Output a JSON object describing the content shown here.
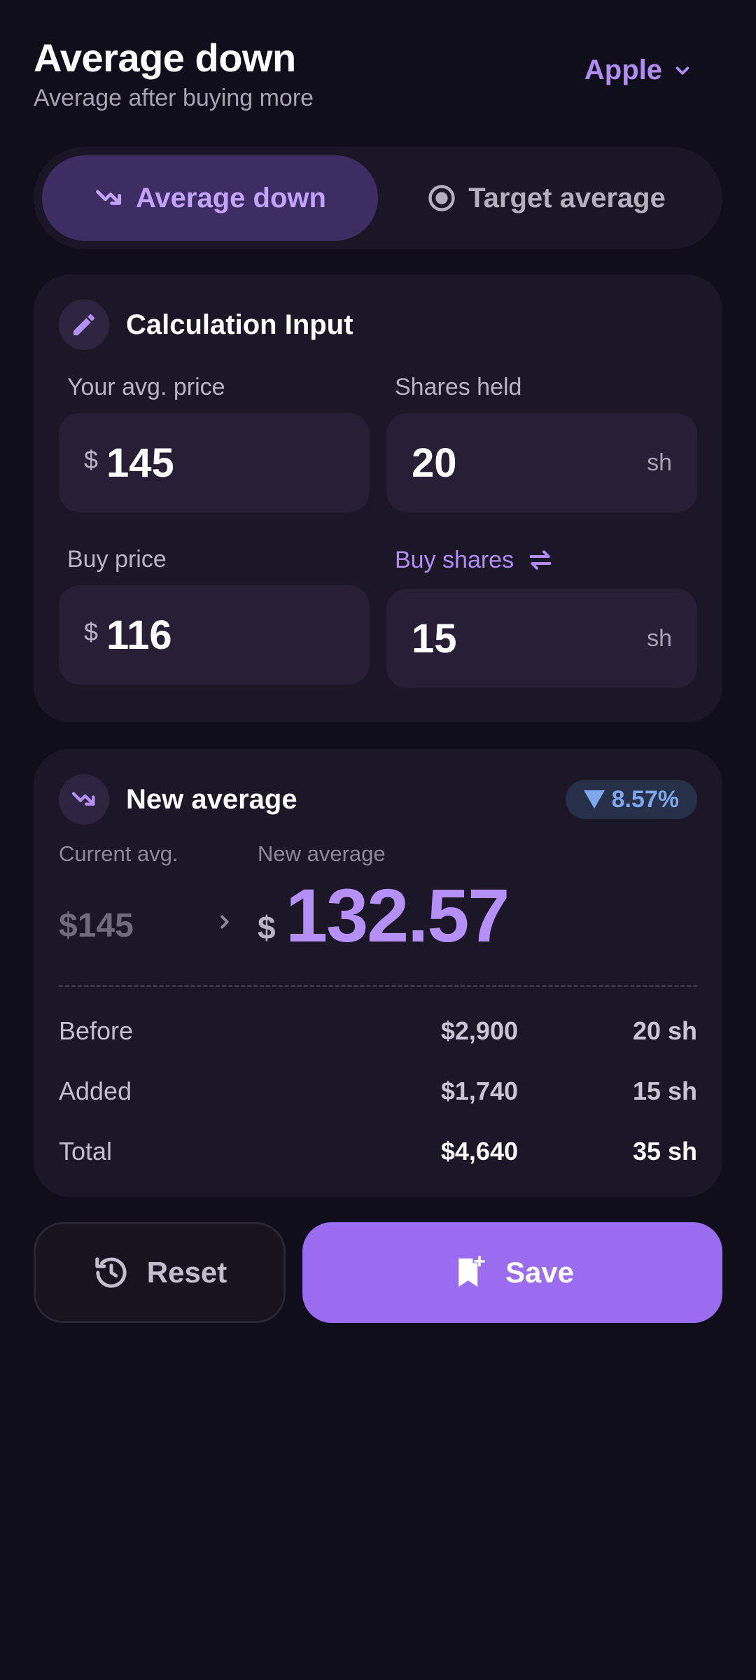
{
  "header": {
    "title": "Average down",
    "subtitle": "Average after buying more",
    "stock": "Apple"
  },
  "tabs": [
    {
      "label": "Average down",
      "icon": "trending-down-icon",
      "active": true
    },
    {
      "label": "Target average",
      "icon": "target-icon",
      "active": false
    }
  ],
  "input_card": {
    "title": "Calculation Input",
    "icon": "pencil-icon",
    "avg_price": {
      "label": "Your avg. price",
      "currency": "$",
      "value": "145"
    },
    "shares_held": {
      "label": "Shares held",
      "value": "20",
      "unit": "sh"
    },
    "buy_price": {
      "label": "Buy price",
      "currency": "$",
      "value": "116"
    },
    "buy_shares": {
      "label": "Buy shares",
      "value": "15",
      "unit": "sh",
      "icon": "swap-icon"
    }
  },
  "result_card": {
    "title": "New average",
    "icon": "trending-down-icon",
    "change_pct": "8.57%",
    "current_label": "Current avg.",
    "current_value": "$145",
    "new_label": "New average",
    "new_currency": "$",
    "new_value": "132.57",
    "rows": [
      {
        "label": "Before",
        "amount": "$2,900",
        "shares": "20 sh"
      },
      {
        "label": "Added",
        "amount": "$1,740",
        "shares": "15 sh"
      },
      {
        "label": "Total",
        "amount": "$4,640",
        "shares": "35 sh"
      }
    ]
  },
  "actions": {
    "reset": "Reset",
    "save": "Save"
  },
  "colors": {
    "background": "#110e1b",
    "card": "#1b1726",
    "accent": "#9a6cf0",
    "accent_text": "#b490f8",
    "down_badge": "#7ea7ec"
  }
}
